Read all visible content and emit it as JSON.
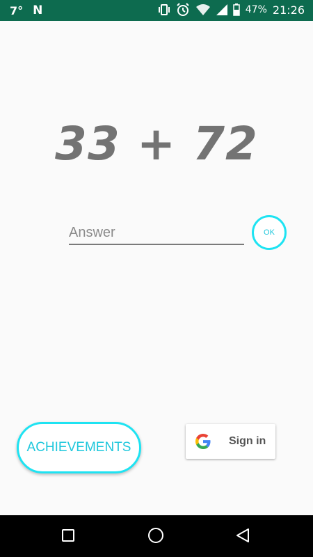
{
  "status_bar": {
    "temperature": "7°",
    "notification_letter": "N",
    "battery_percent": "47%",
    "time": "21:26",
    "background_color": "#0d6b4f",
    "icons": [
      "vibrate-icon",
      "alarm-icon",
      "wifi-icon",
      "signal-icon",
      "battery-icon"
    ]
  },
  "game": {
    "question": "33 + 72"
  },
  "answer": {
    "value": "",
    "placeholder": "Answer"
  },
  "ok_button": {
    "label": "OK"
  },
  "achievements_button": {
    "label": "ACHIEVEMENTS"
  },
  "signin_button": {
    "label": "Sign in",
    "icon": "google-g-icon"
  },
  "nav_bar": {
    "icons": [
      "recents-icon",
      "home-icon",
      "back-icon"
    ]
  },
  "colors": {
    "accent": "#1ee3f2",
    "question_text": "#737373"
  }
}
